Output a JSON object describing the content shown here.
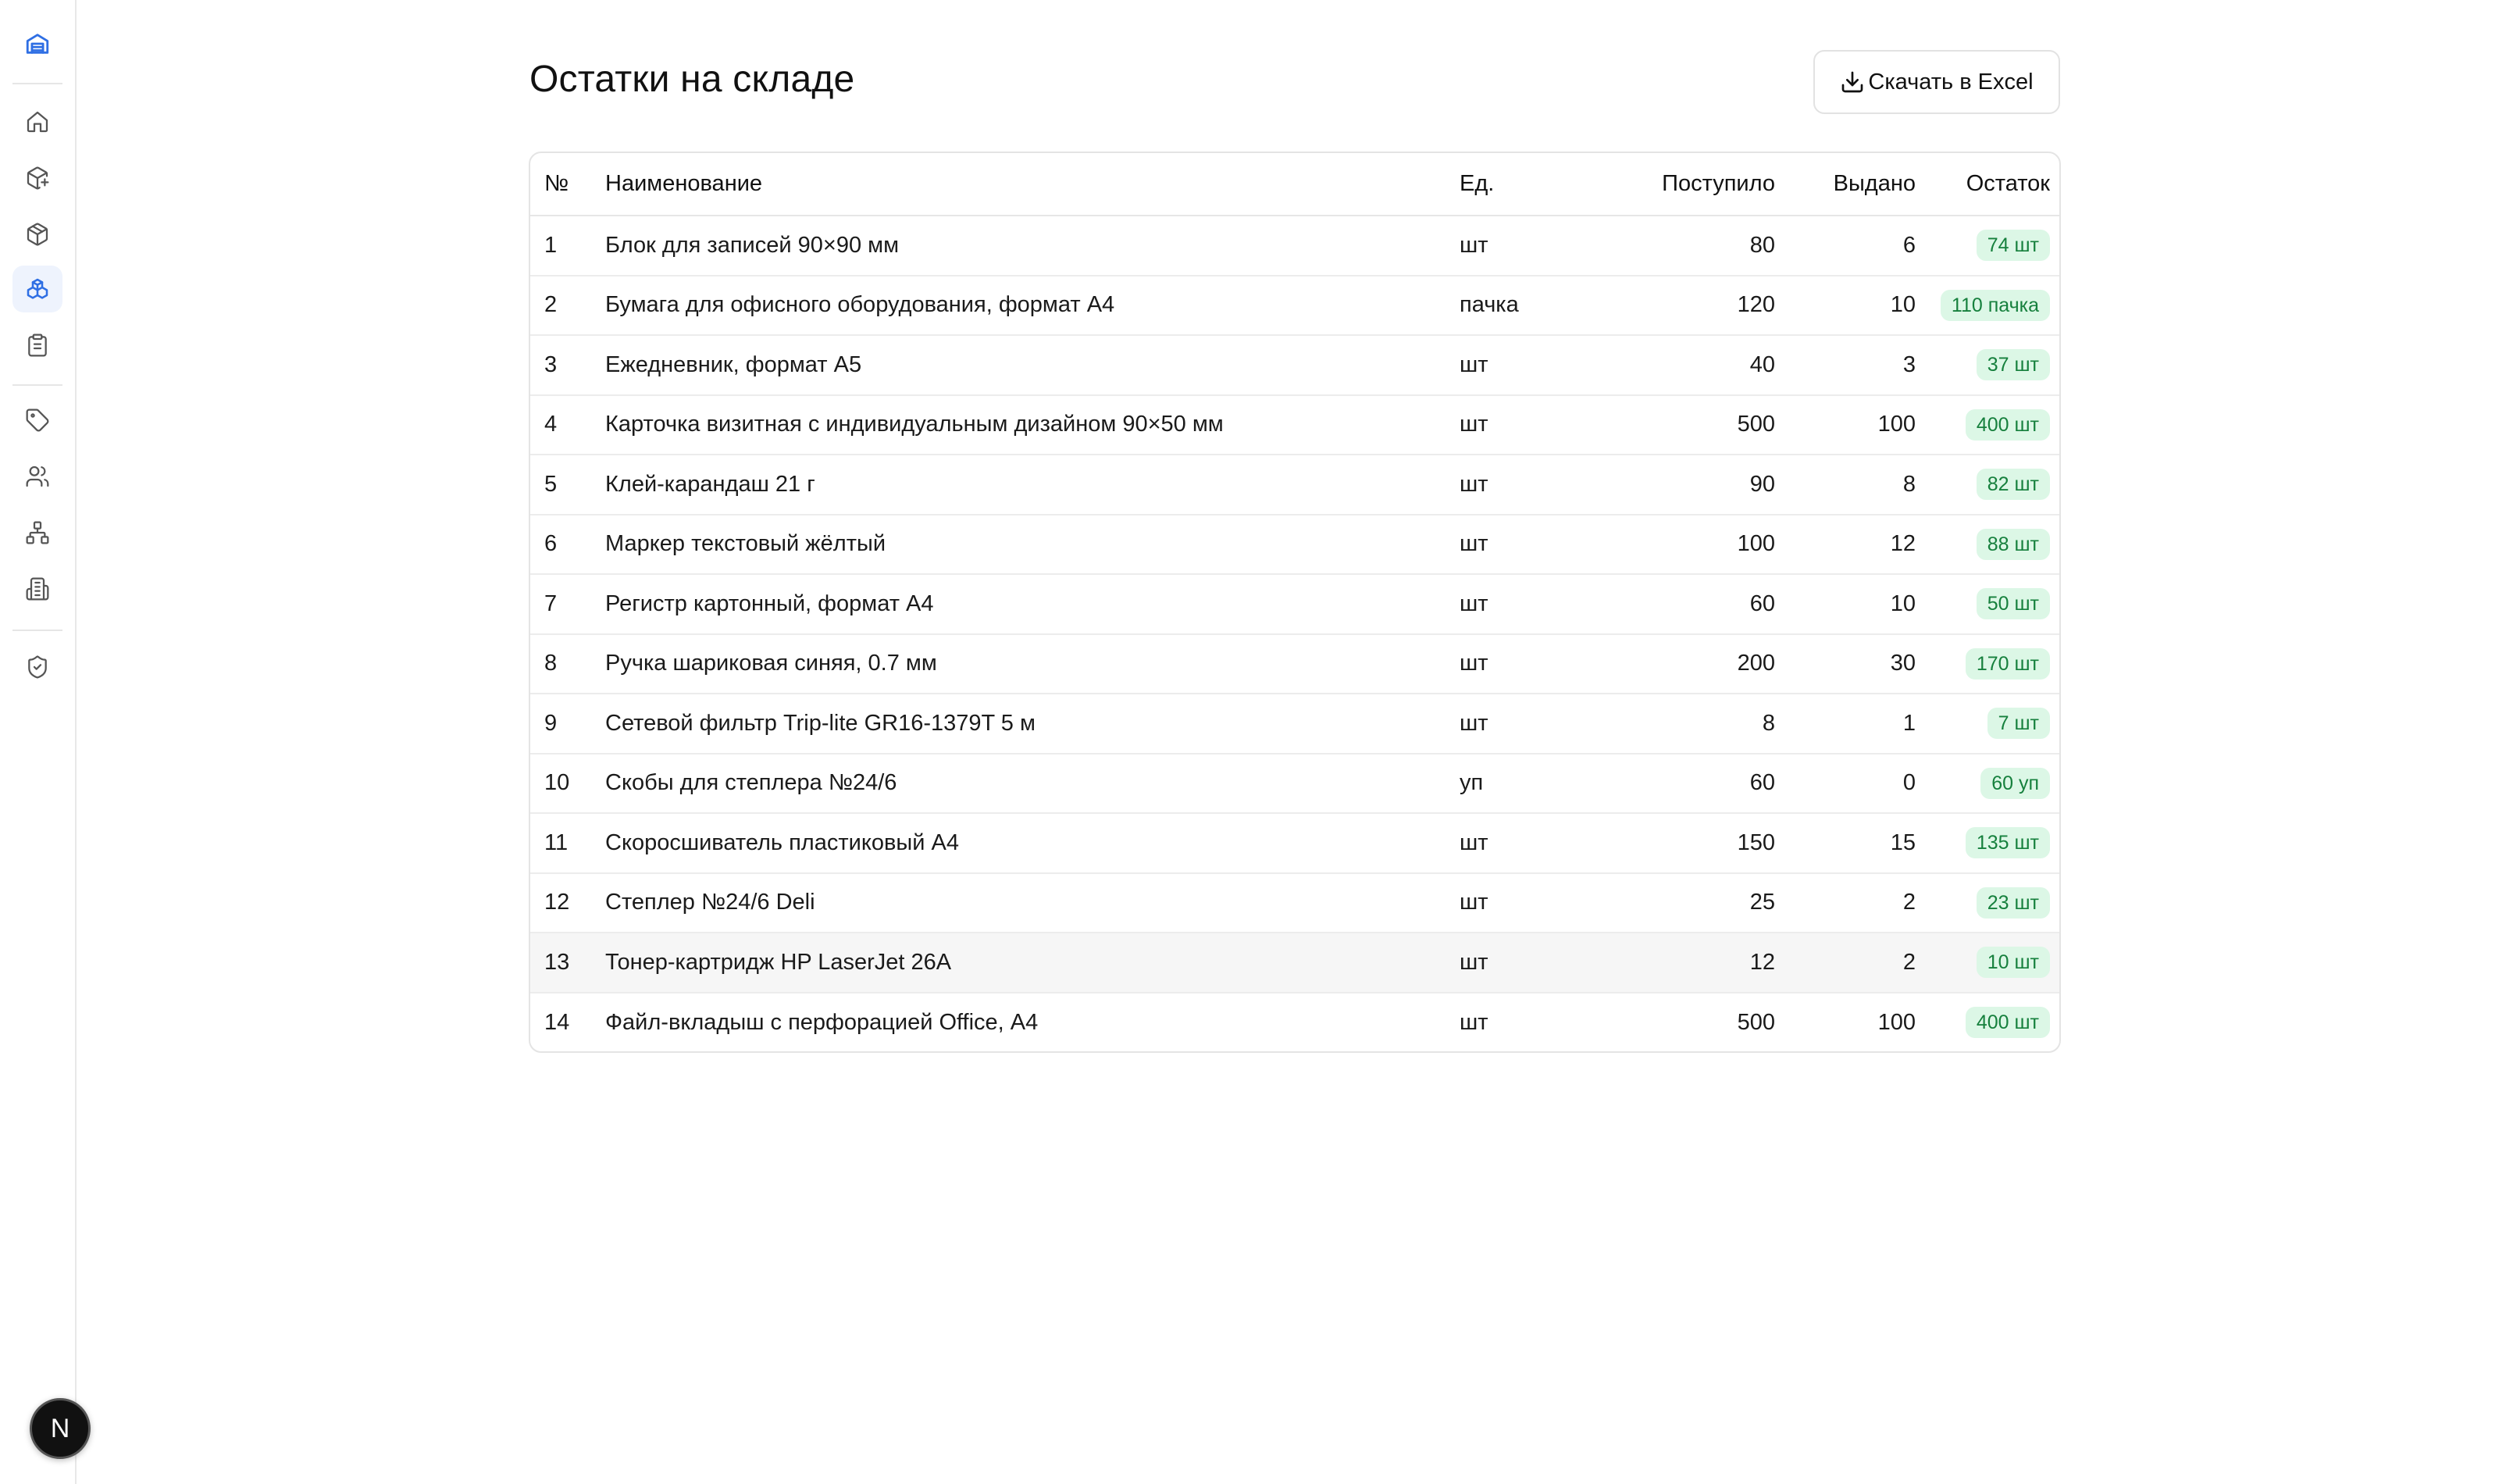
{
  "page": {
    "title": "Остатки на складе",
    "download_label": "Скачать в Excel"
  },
  "user": {
    "avatar_letter": "N"
  },
  "table": {
    "headers": {
      "num": "№",
      "name": "Наименование",
      "unit": "Ед.",
      "received": "Поступило",
      "issued": "Выдано",
      "balance": "Остаток"
    },
    "rows": [
      {
        "num": "1",
        "name": "Блок для записей 90×90 мм",
        "unit": "шт",
        "received": "80",
        "issued": "6",
        "balance": "74 шт"
      },
      {
        "num": "2",
        "name": "Бумага для офисного оборудования, формат А4",
        "unit": "пачка",
        "received": "120",
        "issued": "10",
        "balance": "110 пачка"
      },
      {
        "num": "3",
        "name": "Ежедневник, формат А5",
        "unit": "шт",
        "received": "40",
        "issued": "3",
        "balance": "37 шт"
      },
      {
        "num": "4",
        "name": "Карточка визитная с индивидуальным дизайном 90×50 мм",
        "unit": "шт",
        "received": "500",
        "issued": "100",
        "balance": "400 шт"
      },
      {
        "num": "5",
        "name": "Клей-карандаш 21 г",
        "unit": "шт",
        "received": "90",
        "issued": "8",
        "balance": "82 шт"
      },
      {
        "num": "6",
        "name": "Маркер текстовый жёлтый",
        "unit": "шт",
        "received": "100",
        "issued": "12",
        "balance": "88 шт"
      },
      {
        "num": "7",
        "name": "Регистр картонный, формат А4",
        "unit": "шт",
        "received": "60",
        "issued": "10",
        "balance": "50 шт"
      },
      {
        "num": "8",
        "name": "Ручка шариковая синяя, 0.7 мм",
        "unit": "шт",
        "received": "200",
        "issued": "30",
        "balance": "170 шт"
      },
      {
        "num": "9",
        "name": "Сетевой фильтр Trip-lite GR16-1379T 5 м",
        "unit": "шт",
        "received": "8",
        "issued": "1",
        "balance": "7 шт"
      },
      {
        "num": "10",
        "name": "Скобы для степлера №24/6",
        "unit": "уп",
        "received": "60",
        "issued": "0",
        "balance": "60 уп"
      },
      {
        "num": "11",
        "name": "Скоросшиватель пластиковый А4",
        "unit": "шт",
        "received": "150",
        "issued": "15",
        "balance": "135 шт"
      },
      {
        "num": "12",
        "name": "Степлер №24/6 Deli",
        "unit": "шт",
        "received": "25",
        "issued": "2",
        "balance": "23 шт"
      },
      {
        "num": "13",
        "name": "Тонер-картридж HP LaserJet 26A",
        "unit": "шт",
        "received": "12",
        "issued": "2",
        "balance": "10 шт"
      },
      {
        "num": "14",
        "name": "Файл-вкладыш с перфорацией Office, А4",
        "unit": "шт",
        "received": "500",
        "issued": "100",
        "balance": "400 шт"
      }
    ]
  },
  "colors": {
    "accent": "#2f6fe4",
    "badge_bg": "#dcf7e6",
    "badge_text": "#16803d"
  },
  "icons": {
    "logo": "warehouse-icon",
    "nav": [
      "home-icon",
      "package-plus-icon",
      "package-icon",
      "boxes-icon",
      "clipboard-list-icon",
      "tag-icon",
      "users-icon",
      "network-icon",
      "building-icon",
      "shield-check-icon"
    ],
    "download": "download-icon"
  }
}
